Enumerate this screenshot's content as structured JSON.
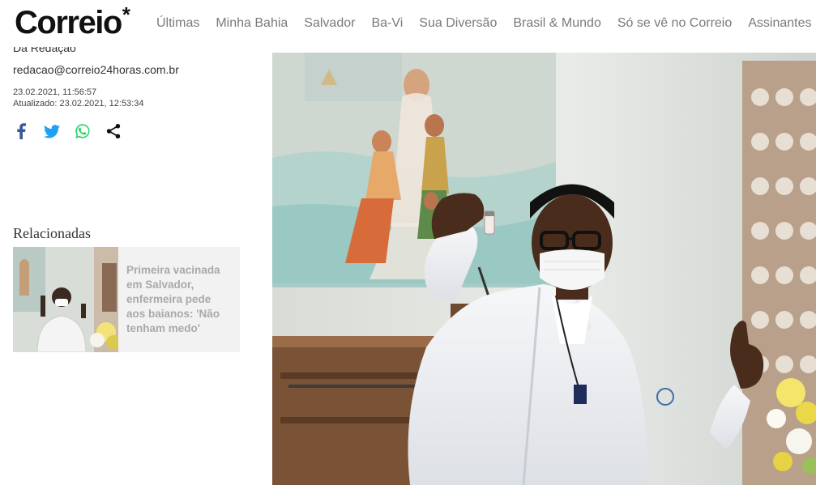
{
  "header": {
    "logo_text": "Correio",
    "logo_star": "*",
    "nav": [
      "Últimas",
      "Minha Bahia",
      "Salvador",
      "Ba-Vi",
      "Sua Diversão",
      "Brasil & Mundo",
      "Só se vê no Correio",
      "Assinantes"
    ]
  },
  "article": {
    "author": "Da Redação",
    "email": "redacao@correio24horas.com.br",
    "published": "23.02.2021, 11:56:57",
    "updated": "Atualizado: 23.02.2021, 12:53:34"
  },
  "share": {
    "icons": [
      "facebook-icon",
      "twitter-icon",
      "whatsapp-icon",
      "share-icon"
    ],
    "colors": {
      "facebook": "#3b5998",
      "twitter": "#1da1f2",
      "whatsapp": "#25d366",
      "share": "#111111"
    }
  },
  "related": {
    "title": "Relacionadas",
    "items": [
      {
        "headline": "Primeira vacinada em Salvador, enfermeira pede aos baianos: 'Não tenham medo'"
      }
    ]
  }
}
